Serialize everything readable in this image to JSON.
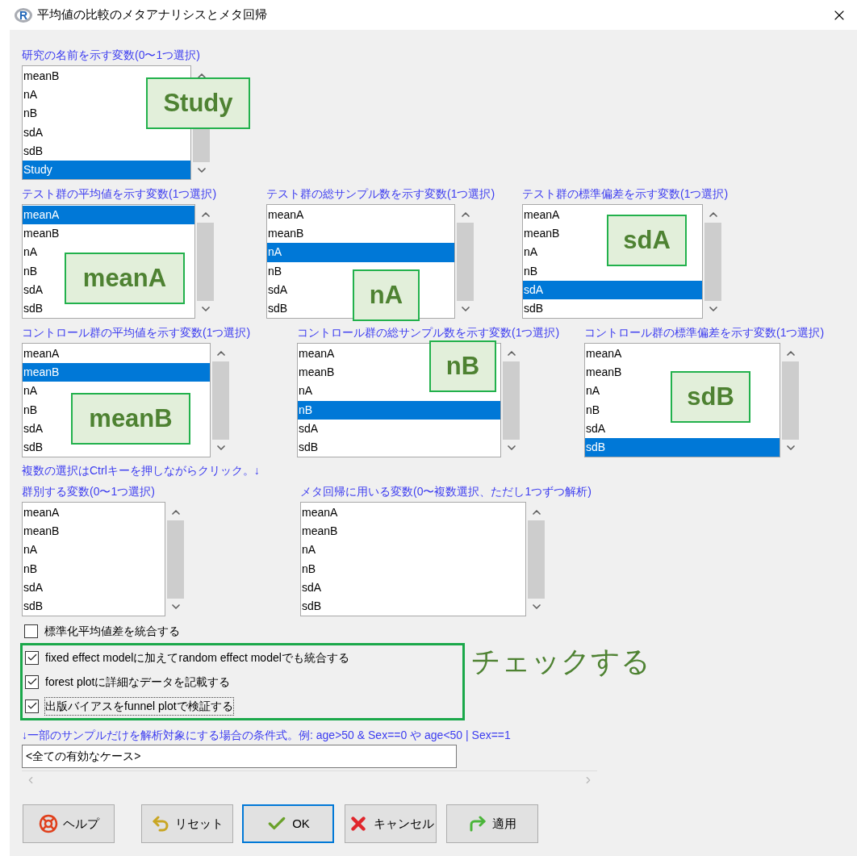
{
  "window": {
    "logo": "R",
    "title": "平均値の比較のメタアナリシスとメタ回帰"
  },
  "listboxes": [
    {
      "label": "研究の名前を示す変数(0〜1つ選択)",
      "annotation": "Study",
      "items": [
        {
          "text": "meanB",
          "selected": false
        },
        {
          "text": "nA",
          "selected": false
        },
        {
          "text": "nB",
          "selected": false
        },
        {
          "text": "sdA",
          "selected": false
        },
        {
          "text": "sdB",
          "selected": false
        },
        {
          "text": "Study",
          "selected": true
        }
      ]
    },
    {
      "label": "テスト群の平均値を示す変数(1つ選択)",
      "annotation": "meanA",
      "items": [
        {
          "text": "meanA",
          "selected": true
        },
        {
          "text": "meanB",
          "selected": false
        },
        {
          "text": "nA",
          "selected": false
        },
        {
          "text": "nB",
          "selected": false
        },
        {
          "text": "sdA",
          "selected": false
        },
        {
          "text": "sdB",
          "selected": false
        }
      ]
    },
    {
      "label": "テスト群の総サンプル数を示す変数(1つ選択)",
      "annotation": "nA",
      "items": [
        {
          "text": "meanA",
          "selected": false
        },
        {
          "text": "meanB",
          "selected": false
        },
        {
          "text": "nA",
          "selected": true
        },
        {
          "text": "nB",
          "selected": false
        },
        {
          "text": "sdA",
          "selected": false
        },
        {
          "text": "sdB",
          "selected": false
        }
      ]
    },
    {
      "label": "テスト群の標準偏差を示す変数(1つ選択)",
      "annotation": "sdA",
      "items": [
        {
          "text": "meanA",
          "selected": false
        },
        {
          "text": "meanB",
          "selected": false
        },
        {
          "text": "nA",
          "selected": false
        },
        {
          "text": "nB",
          "selected": false
        },
        {
          "text": "sdA",
          "selected": true
        },
        {
          "text": "sdB",
          "selected": false
        }
      ]
    },
    {
      "label": "コントロール群の平均値を示す変数(1つ選択)",
      "annotation": "meanB",
      "items": [
        {
          "text": "meanA",
          "selected": false
        },
        {
          "text": "meanB",
          "selected": true
        },
        {
          "text": "nA",
          "selected": false
        },
        {
          "text": "nB",
          "selected": false
        },
        {
          "text": "sdA",
          "selected": false
        },
        {
          "text": "sdB",
          "selected": false
        }
      ]
    },
    {
      "label": "コントロール群の総サンプル数を示す変数(1つ選択)",
      "annotation": "nB",
      "items": [
        {
          "text": "meanA",
          "selected": false
        },
        {
          "text": "meanB",
          "selected": false
        },
        {
          "text": "nA",
          "selected": false
        },
        {
          "text": "nB",
          "selected": true
        },
        {
          "text": "sdA",
          "selected": false
        },
        {
          "text": "sdB",
          "selected": false
        }
      ]
    },
    {
      "label": "コントロール群の標準偏差を示す変数(1つ選択)",
      "annotation": "sdB",
      "items": [
        {
          "text": "meanA",
          "selected": false
        },
        {
          "text": "meanB",
          "selected": false
        },
        {
          "text": "nA",
          "selected": false
        },
        {
          "text": "nB",
          "selected": false
        },
        {
          "text": "sdA",
          "selected": false
        },
        {
          "text": "sdB",
          "selected": true
        }
      ]
    },
    {
      "label": "群別する変数(0〜1つ選択)",
      "items": [
        {
          "text": "meanA",
          "selected": false
        },
        {
          "text": "meanB",
          "selected": false
        },
        {
          "text": "nA",
          "selected": false
        },
        {
          "text": "nB",
          "selected": false
        },
        {
          "text": "sdA",
          "selected": false
        },
        {
          "text": "sdB",
          "selected": false
        }
      ]
    },
    {
      "label": "メタ回帰に用いる変数(0〜複数選択、ただし1つずつ解析)",
      "items": [
        {
          "text": "meanA",
          "selected": false
        },
        {
          "text": "meanB",
          "selected": false
        },
        {
          "text": "nA",
          "selected": false
        },
        {
          "text": "nB",
          "selected": false
        },
        {
          "text": "sdA",
          "selected": false
        },
        {
          "text": "sdB",
          "selected": false
        }
      ]
    }
  ],
  "note": "複数の選択はCtrlキーを押しながらクリック。↓",
  "checkboxes": [
    {
      "label": "標準化平均値差を統合する",
      "checked": false
    },
    {
      "label": "fixed effect modelに加えてrandom effect modelでも統合する",
      "checked": true
    },
    {
      "label": "forest plotに詳細なデータを記載する",
      "checked": true
    },
    {
      "label": "出版バイアスをfunnel plotで検証する",
      "checked": true
    }
  ],
  "callout": "チェックする",
  "condition": {
    "label": "↓一部のサンプルだけを解析対象にする場合の条件式。例: age>50 & Sex==0 や age<50 | Sex==1",
    "value": "<全ての有効なケース>"
  },
  "buttons": [
    {
      "kind": "help",
      "label": "ヘルプ",
      "default": false
    },
    {
      "kind": "reset",
      "label": "リセット",
      "default": false
    },
    {
      "kind": "ok",
      "label": "OK",
      "default": true
    },
    {
      "kind": "cancel",
      "label": "キャンセル",
      "default": false
    },
    {
      "kind": "apply",
      "label": "適用",
      "default": false
    }
  ]
}
